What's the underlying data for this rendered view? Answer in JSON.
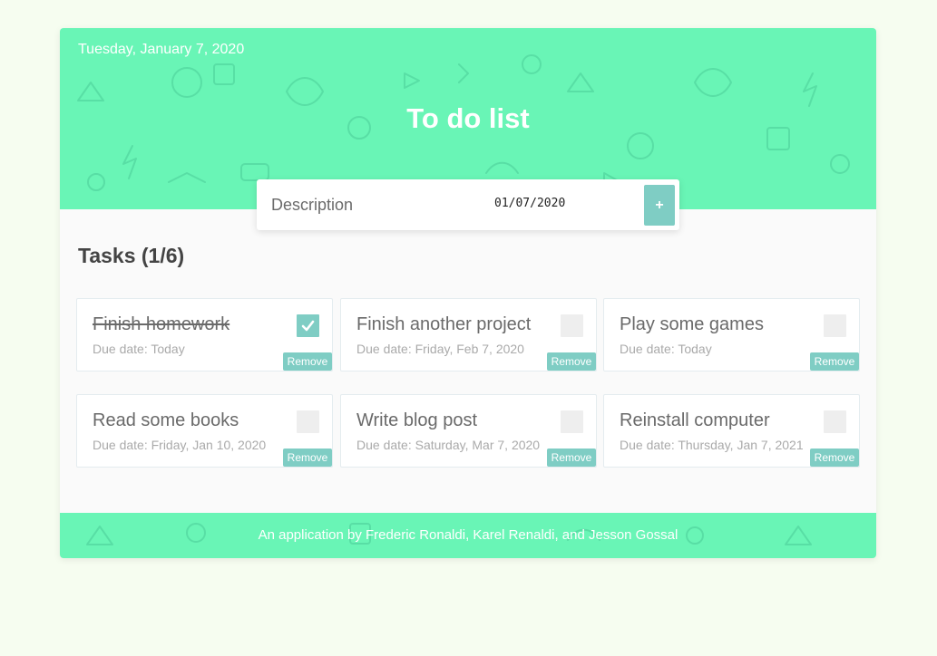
{
  "header": {
    "date": "Tuesday, January 7, 2020",
    "title": "To do list"
  },
  "form": {
    "description_placeholder": "Description",
    "date_value": "01/07/2020",
    "add_label": "+"
  },
  "tasks": {
    "heading": "Tasks (1/6)",
    "remove_label": "Remove",
    "items": [
      {
        "title": "Finish homework",
        "due": "Due date: Today",
        "done": true
      },
      {
        "title": "Finish another project",
        "due": "Due date: Friday, Feb 7, 2020",
        "done": false
      },
      {
        "title": "Play some games",
        "due": "Due date: Today",
        "done": false
      },
      {
        "title": "Read some books",
        "due": "Due date: Friday, Jan 10, 2020",
        "done": false
      },
      {
        "title": "Write blog post",
        "due": "Due date: Saturday, Mar 7, 2020",
        "done": false
      },
      {
        "title": "Reinstall computer",
        "due": "Due date: Thursday, Jan 7, 2021",
        "done": false
      }
    ]
  },
  "footer": {
    "text": "An application by Frederic Ronaldi, Karel Renaldi, and Jesson Gossal"
  },
  "colors": {
    "header_bg": "#69f5b6",
    "accent": "#7fcdc4",
    "page_bg": "#f6fdf0"
  },
  "icons": {
    "check": "check-icon",
    "header_pattern": "doodle-pattern"
  }
}
